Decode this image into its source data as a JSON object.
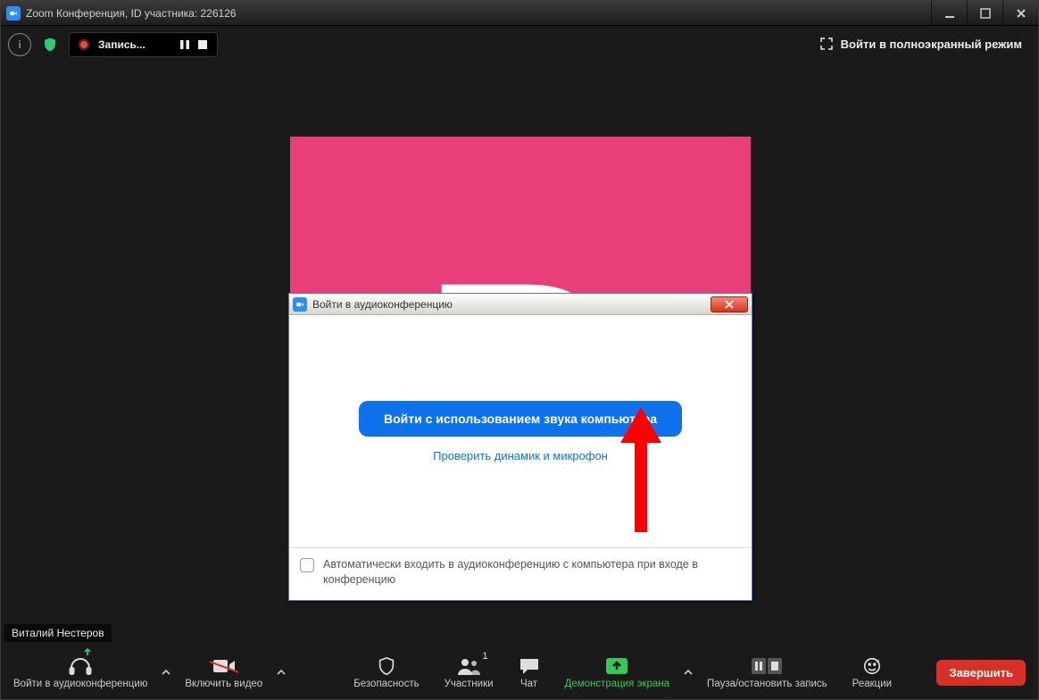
{
  "window": {
    "title": "Zoom Конференция, ID участника: 226126"
  },
  "topbar": {
    "recording_label": "Запись...",
    "fullscreen_label": "Войти в полноэкранный режим"
  },
  "participant": {
    "name": "Виталий Нестеров",
    "initial": "В"
  },
  "dialog": {
    "title": "Войти в аудиоконференцию",
    "primary_button": "Войти с использованием звука компьютера",
    "test_link": "Проверить динамик и микрофон",
    "auto_checkbox_label": "Автоматически входить в аудиоконференцию с компьютера при входе в конференцию"
  },
  "bottombar": {
    "audio": "Войти в аудиоконференцию",
    "video": "Включить видео",
    "security": "Безопасность",
    "participants": "Участники",
    "participants_count": "1",
    "chat": "Чат",
    "share": "Демонстрация экрана",
    "record": "Пауза/остановить запись",
    "reactions": "Реакции",
    "end": "Завершить"
  },
  "colors": {
    "accent": "#0e72ed",
    "tile": "#e83e7a",
    "share_green": "#35c759",
    "danger": "#d93025"
  }
}
